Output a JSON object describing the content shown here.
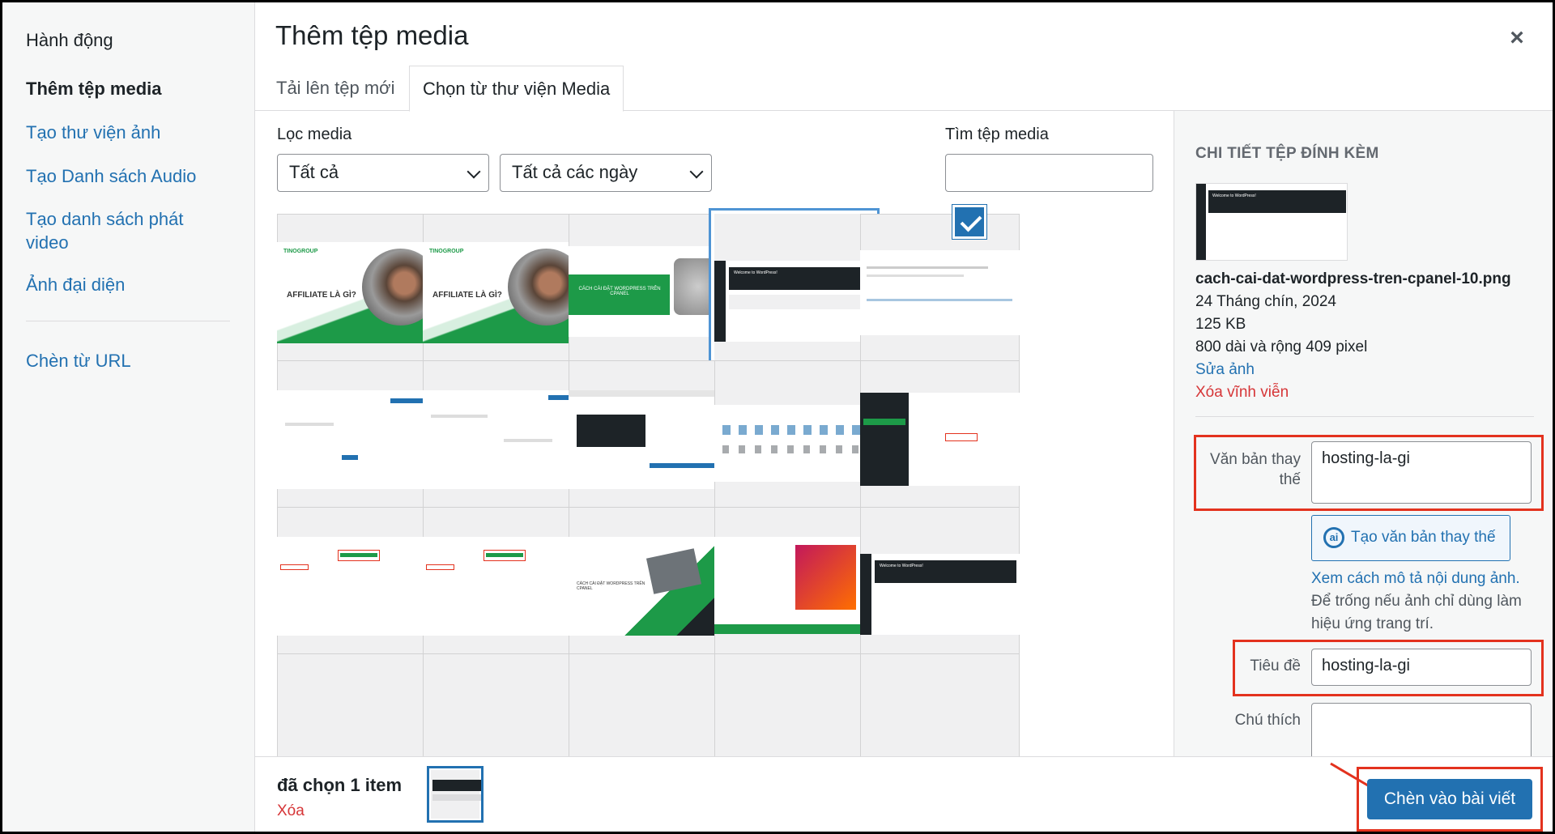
{
  "menu": {
    "heading": "Hành động",
    "items": [
      {
        "label": "Thêm tệp media",
        "active": true
      },
      {
        "label": "Tạo thư viện ảnh"
      },
      {
        "label": "Tạo Danh sách Audio"
      },
      {
        "label": "Tạo danh sách phát video"
      },
      {
        "label": "Ảnh đại diện"
      }
    ],
    "url_item": "Chèn từ URL"
  },
  "header": {
    "title": "Thêm tệp media",
    "close_icon": "close-icon ×"
  },
  "tabs": [
    "Tải lên tệp mới",
    "Chọn từ thư viện Media"
  ],
  "filters": {
    "filter_label": "Lọc media",
    "type_value": "Tất cả",
    "date_value": "Tất cả các ngày",
    "search_label": "Tìm tệp media",
    "search_value": ""
  },
  "thumb_texts": {
    "affiliate": "AFFILIATE LÀ GÌ?",
    "brand": "TINOGROUP",
    "cpanel": "CÁCH CÀI ĐẶT WORDPRESS TRÊN CPANEL",
    "welcome": "Welcome to WordPress!"
  },
  "details": {
    "heading": "CHI TIẾT TỆP ĐÍNH KÈM",
    "filename": "cach-cai-dat-wordpress-tren-cpanel-10.png",
    "date": "24 Tháng chín, 2024",
    "size": "125 KB",
    "dimensions": "800 dài và rộng 409 pixel",
    "edit_link": "Sửa ảnh",
    "delete_link": "Xóa vĩnh viễn",
    "alt_label": "Văn bản thay thế",
    "alt_value": "hosting-la-gi",
    "ai_button": "Tạo văn bản thay thế",
    "help_link": "Xem cách mô tả nội dung ảnh.",
    "help_text": "Để trống nếu ảnh chỉ dùng làm hiệu ứng trang trí.",
    "title_label": "Tiêu đề",
    "title_value": "hosting-la-gi",
    "caption_label": "Chú thích",
    "caption_value": ""
  },
  "footer": {
    "selected_count": "đã chọn 1 item",
    "clear_link": "Xóa",
    "insert_button": "Chèn vào bài viết"
  },
  "colors": {
    "accent": "#2271b1",
    "danger": "#d63638",
    "highlight": "#e3321e"
  }
}
